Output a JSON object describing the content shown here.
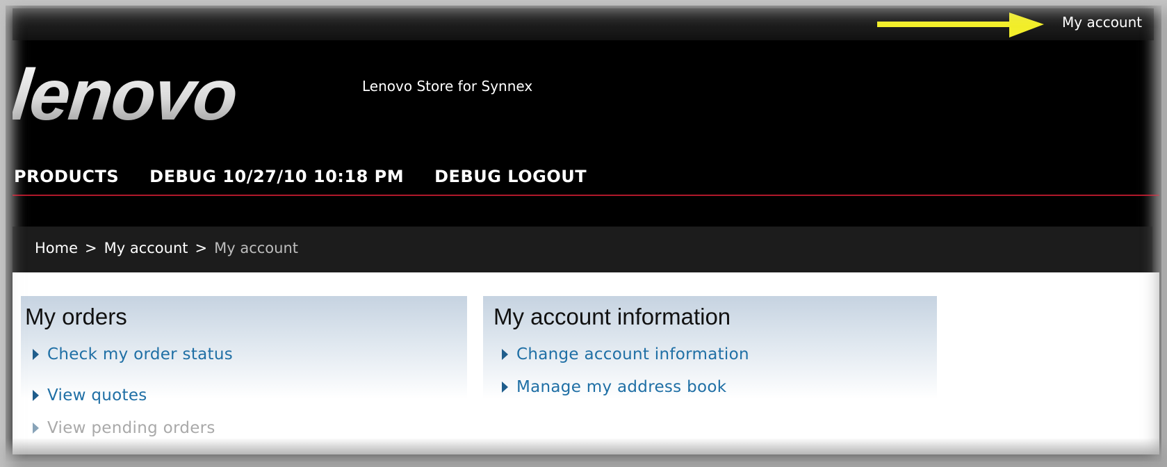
{
  "header": {
    "my_account_link": "My account",
    "store_name": "Lenovo Store for Synnex",
    "logo_text": "lenovo"
  },
  "nav": {
    "items": [
      "PRODUCTS",
      "DEBUG 10/27/10 10:18 PM",
      "DEBUG LOGOUT"
    ]
  },
  "breadcrumb": {
    "items": [
      "Home",
      "My account",
      "My account"
    ],
    "separator": ">"
  },
  "orders_panel": {
    "title": "My orders",
    "links": [
      "Check my order status",
      "View quotes",
      "View pending orders"
    ]
  },
  "account_panel": {
    "title": "My account information",
    "links": [
      "Change account information",
      "Manage my address book"
    ]
  },
  "colors": {
    "annotation_arrow": "#f2ee2a",
    "link": "#1f6fa5",
    "nav_rule": "#b0182a",
    "disabled_link": "#a9a9a9"
  },
  "icons": {
    "annotation": "arrow-right-icon",
    "link_bullet": "triangle-right-icon"
  }
}
